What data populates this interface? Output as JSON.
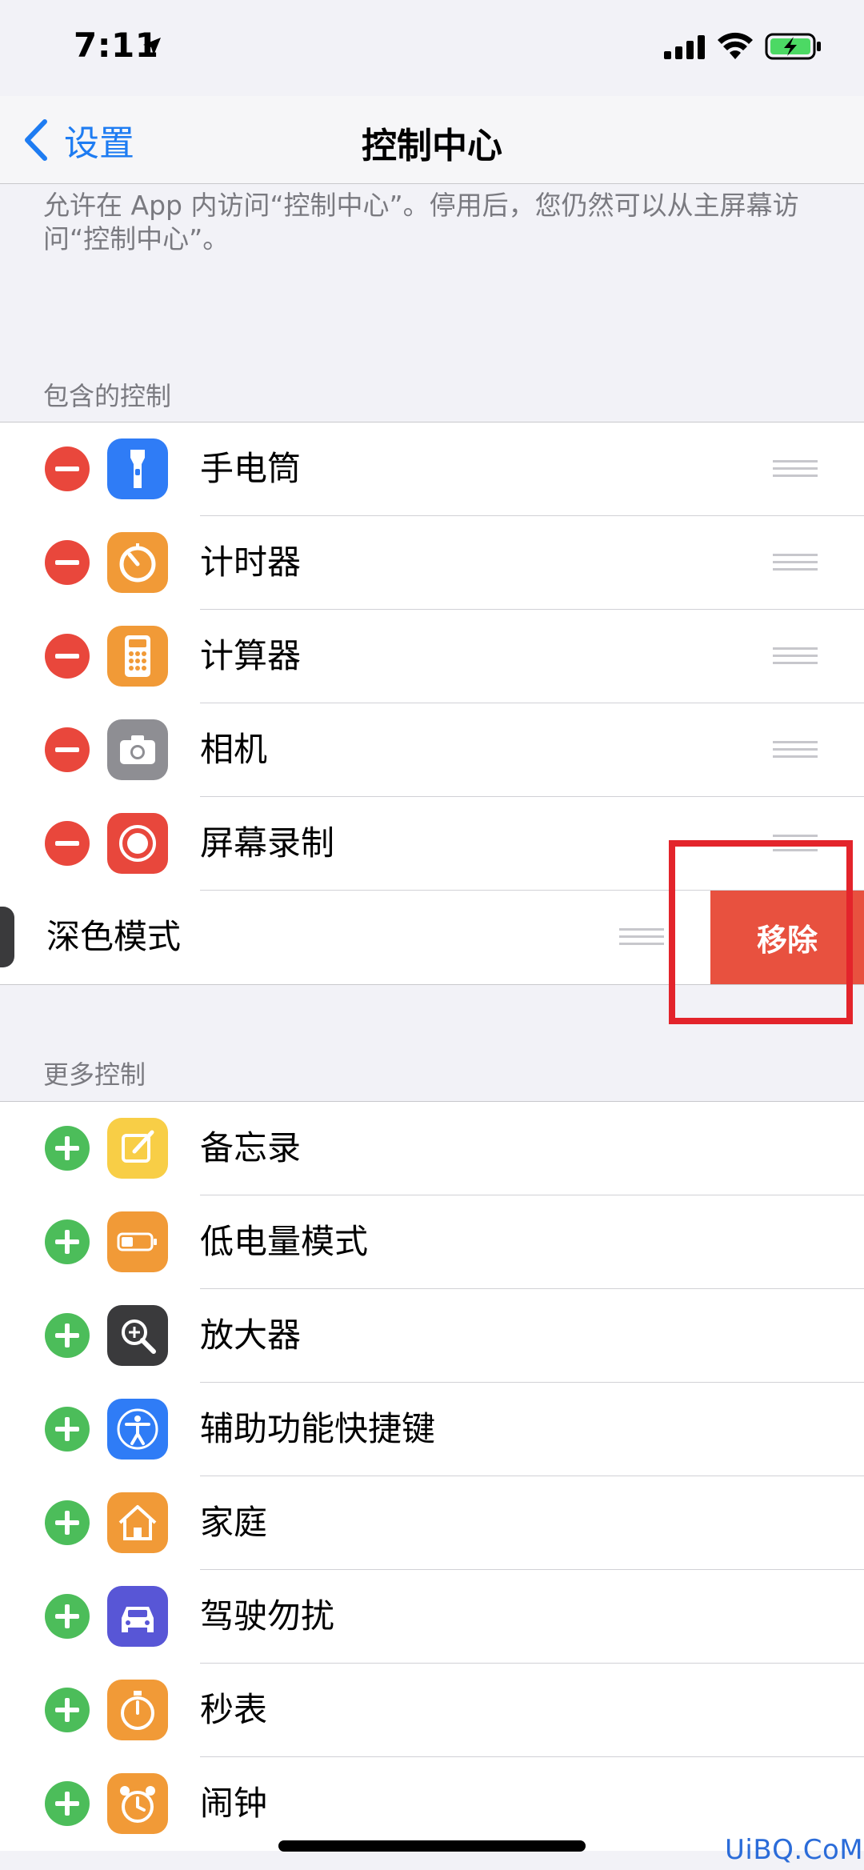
{
  "status_bar": {
    "time": "7:11"
  },
  "nav": {
    "back_label": "设置",
    "title": "控制中心"
  },
  "description": "允许在 App 内访问“控制中心”。停用后，您仍然可以从主屏幕访问“控制中心”。",
  "included": {
    "header": "包含的控制",
    "items": [
      {
        "label": "手电筒",
        "icon": "flashlight-icon",
        "color": "#2f7cf6"
      },
      {
        "label": "计时器",
        "icon": "timer-icon",
        "color": "#f19a37"
      },
      {
        "label": "计算器",
        "icon": "calculator-icon",
        "color": "#f19a37"
      },
      {
        "label": "相机",
        "icon": "camera-icon",
        "color": "#8e8e93"
      },
      {
        "label": "屏幕录制",
        "icon": "screen-record-icon",
        "color": "#e8473c"
      }
    ],
    "swiped_item": {
      "label": "深色模式",
      "icon": "dark-mode-icon",
      "action_label": "移除"
    }
  },
  "more": {
    "header": "更多控制",
    "items": [
      {
        "label": "备忘录",
        "icon": "notes-icon",
        "color": "#f8ce46"
      },
      {
        "label": "低电量模式",
        "icon": "low-power-icon",
        "color": "#f19a37"
      },
      {
        "label": "放大器",
        "icon": "magnifier-icon",
        "color": "#3a3a3c"
      },
      {
        "label": "辅助功能快捷键",
        "icon": "accessibility-icon",
        "color": "#2f7cf6"
      },
      {
        "label": "家庭",
        "icon": "home-icon",
        "color": "#f19a37"
      },
      {
        "label": "驾驶勿扰",
        "icon": "car-icon",
        "color": "#5856d6"
      },
      {
        "label": "秒表",
        "icon": "stopwatch-icon",
        "color": "#f19a37"
      },
      {
        "label": "闹钟",
        "icon": "alarm-icon",
        "color": "#f19a37"
      }
    ]
  },
  "watermark": "UiBQ.CoM"
}
